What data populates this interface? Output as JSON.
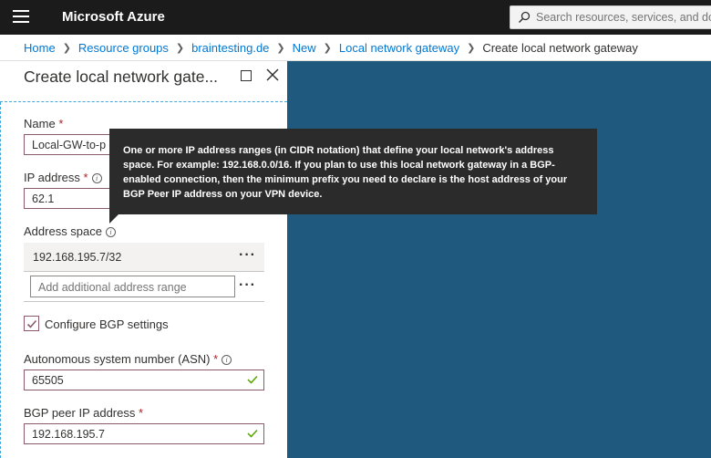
{
  "header": {
    "brand": "Microsoft Azure",
    "search_placeholder": "Search resources, services, and docs"
  },
  "breadcrumb": {
    "items": [
      "Home",
      "Resource groups",
      "braintesting.de",
      "New",
      "Local network gateway"
    ],
    "current": "Create local network gateway"
  },
  "blade": {
    "title": "Create local network gate...",
    "name_label": "Name",
    "name_value": "Local-GW-to-p",
    "ip_label": "IP address",
    "ip_value": "62.1",
    "address_space_label": "Address space",
    "address_space_entry": "192.168.195.7/32",
    "add_range_placeholder": "Add additional address range",
    "bgp_checkbox_label": "Configure BGP settings",
    "bgp_checked": true,
    "asn_label": "Autonomous system number (ASN)",
    "asn_value": "65505",
    "bgp_peer_label": "BGP peer IP address",
    "bgp_peer_value": "192.168.195.7"
  },
  "tooltip": {
    "text": "One or more IP address ranges (in CIDR notation) that define your local network's address space. For example: 192.168.0.0/16. If you plan to use this local network gateway in a BGP-enabled connection, then the minimum prefix you need to declare is the host address of your BGP Peer IP address on your VPN device."
  },
  "colors": {
    "topbar": "#1b1b1b",
    "link": "#0078d4",
    "canvas": "#1f5a7e",
    "valid_check": "#57a300",
    "required": "#a4262c"
  }
}
